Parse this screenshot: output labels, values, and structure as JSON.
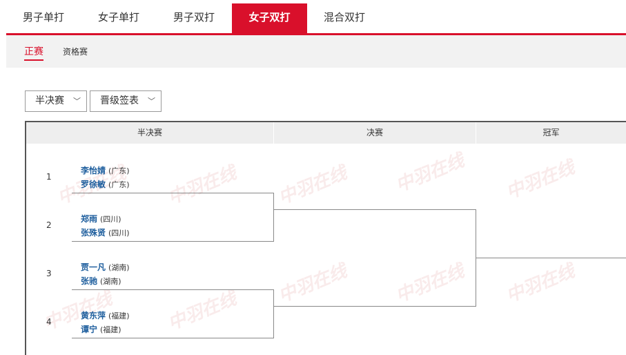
{
  "event_tabs": [
    "男子单打",
    "女子单打",
    "男子双打",
    "女子双打",
    "混合双打"
  ],
  "active_event": "女子双打",
  "sub_tabs": [
    "正赛",
    "资格赛"
  ],
  "active_sub": "正赛",
  "filters": {
    "round": "半决赛",
    "view": "晋级签表"
  },
  "columns": [
    "半决赛",
    "决赛",
    "冠军"
  ],
  "watermark": "中羽在线",
  "matches": [
    {
      "seed": "1",
      "p1": "李怡婧",
      "p1_prov": "(广东)",
      "p2": "罗徐敏",
      "p2_prov": "(广东)"
    },
    {
      "seed": "2",
      "p1": "郑雨",
      "p1_prov": "(四川)",
      "p2": "张殊贤",
      "p2_prov": "(四川)"
    },
    {
      "seed": "3",
      "p1": "贾一凡",
      "p1_prov": "(湖南)",
      "p2": "张驰",
      "p2_prov": "(湖南)"
    },
    {
      "seed": "4",
      "p1": "黄东萍",
      "p1_prov": "(福建)",
      "p2": "谭宁",
      "p2_prov": "(福建)"
    }
  ],
  "colors": {
    "accent": "#d9102b",
    "player": "#1f5f9e"
  }
}
